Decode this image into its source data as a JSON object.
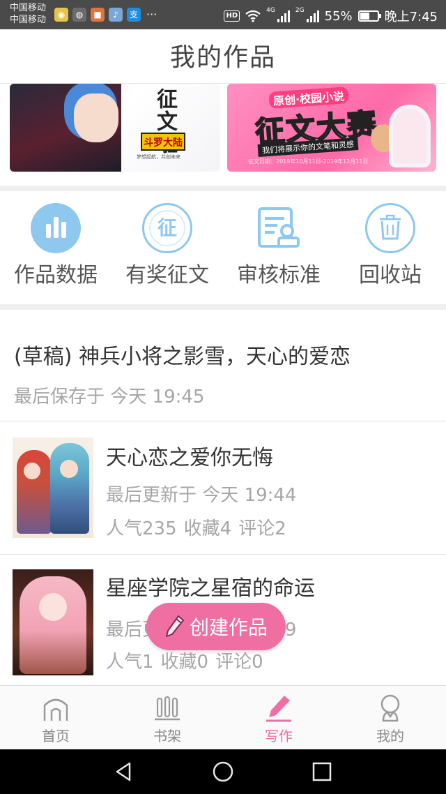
{
  "status_bar": {
    "carrier_1": "中国移动",
    "carrier_2": "中国移动",
    "app_icons": [
      "wechat-icon",
      "wechat-icon",
      "video-icon",
      "music-icon",
      "alipay-icon"
    ],
    "alipay_glyph": "支",
    "more": "···",
    "hd": "HD",
    "network_1": "4G",
    "network_2": "2G",
    "battery": "55%",
    "battery_level": 0.55,
    "time": "晚上7:45"
  },
  "header": {
    "title": "我的作品"
  },
  "banners": {
    "left": {
      "headline": "征文啦",
      "tag": "斗罗大陆",
      "subtitle": "梦想起航，共创未来"
    },
    "right": {
      "kicker": "原创·校园小说",
      "headline": "征文大赛",
      "strip": "我们将展示你的文笔和灵感",
      "footnote": "征文日期：2019年10月11日-2019年12月11日"
    }
  },
  "quick_actions": [
    {
      "id": "data",
      "label": "作品数据",
      "icon": "bar-chart-icon"
    },
    {
      "id": "contest",
      "label": "有奖征文",
      "icon": "contest-icon",
      "glyph": "征"
    },
    {
      "id": "review",
      "label": "审核标准",
      "icon": "review-standard-icon"
    },
    {
      "id": "recycle",
      "label": "回收站",
      "icon": "trash-icon"
    }
  ],
  "draft": {
    "title": "(草稿) 神兵小将之影雪，天心的爱恋",
    "saved_at": "最后保存于 今天 19:45"
  },
  "works": [
    {
      "title": "天心恋之爱你无悔",
      "updated_at": "最后更新于 今天 19:44",
      "popularity": "人气235",
      "favorites": "收藏4",
      "comments": "评论2"
    },
    {
      "title": "星座学院之星宿的命运",
      "updated_at": "最后更新于 今天 19:39",
      "popularity": "人气1",
      "favorites": "收藏0",
      "comments": "评论0"
    }
  ],
  "fab": {
    "label": "创建作品",
    "icon": "pencil-icon"
  },
  "tabs": [
    {
      "id": "home",
      "label": "首页",
      "icon": "home-icon",
      "active": false
    },
    {
      "id": "shelf",
      "label": "书架",
      "icon": "bookshelf-icon",
      "active": false
    },
    {
      "id": "write",
      "label": "写作",
      "icon": "write-icon",
      "active": true
    },
    {
      "id": "mine",
      "label": "我的",
      "icon": "profile-icon",
      "active": false
    }
  ],
  "colors": {
    "accent": "#f06fa2",
    "icon_blue": "#8ec8ee",
    "icon_blue_light": "#d8edfb",
    "status_bar": "#4a4a4a",
    "secondary_text": "#a6a6a6"
  }
}
